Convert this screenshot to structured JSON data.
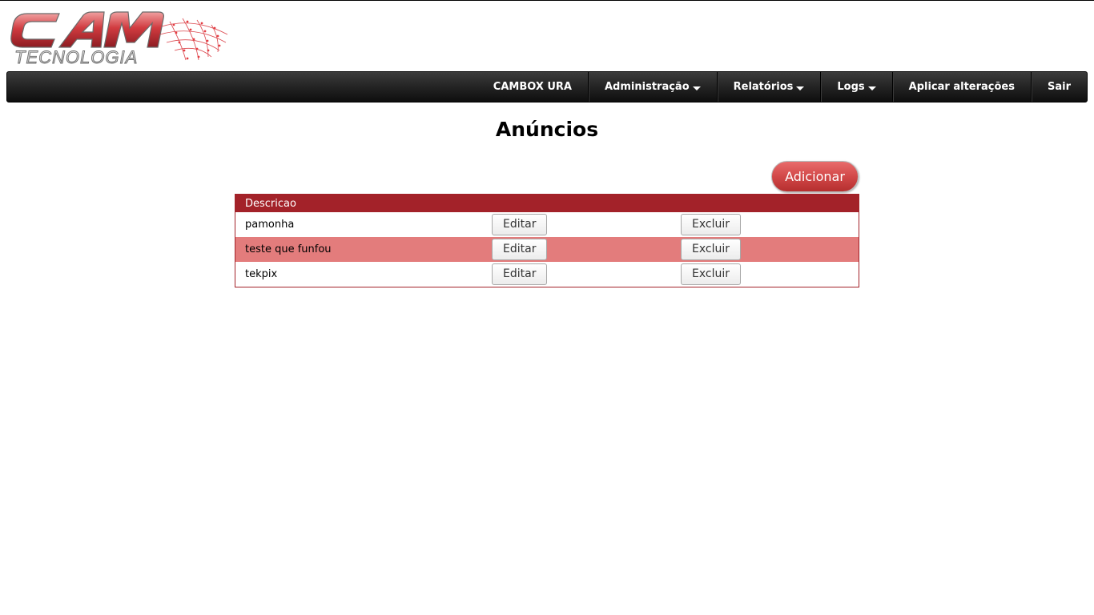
{
  "logo": {
    "primary_text": "CAM",
    "secondary_text": "TECNOLOGIA",
    "accent_color": "#c8323a"
  },
  "nav": {
    "items": [
      {
        "label": "CAMBOX URA",
        "dropdown": false
      },
      {
        "label": "Administração",
        "dropdown": true
      },
      {
        "label": "Relatórios",
        "dropdown": true
      },
      {
        "label": "Logs",
        "dropdown": true
      },
      {
        "label": "Aplicar alterações",
        "dropdown": false
      },
      {
        "label": "Sair",
        "dropdown": false
      }
    ]
  },
  "page": {
    "title": "Anúncios",
    "add_label": "Adicionar"
  },
  "table": {
    "header": "Descricao",
    "rows": [
      {
        "description": "pamonha",
        "edit_label": "Editar",
        "delete_label": "Excluir"
      },
      {
        "description": "teste que funfou",
        "edit_label": "Editar",
        "delete_label": "Excluir"
      },
      {
        "description": "tekpix",
        "edit_label": "Editar",
        "delete_label": "Excluir"
      }
    ]
  },
  "colors": {
    "header_bg": "#a32229",
    "alt_row_bg": "#e37c7c",
    "navbar_bg": "#1e1e1e",
    "add_button_bg": "#d24848"
  }
}
